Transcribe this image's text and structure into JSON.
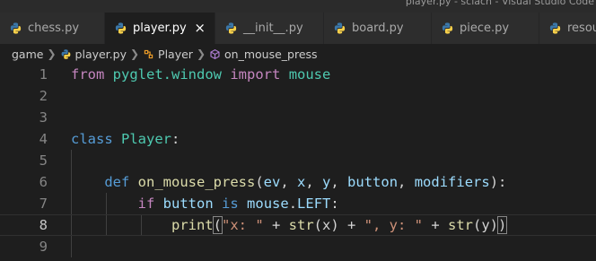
{
  "window": {
    "title": "player.py - sclach - Visual Studio Code"
  },
  "tabs": [
    {
      "label": "chess.py",
      "active": false
    },
    {
      "label": "player.py",
      "active": true,
      "close": "×"
    },
    {
      "label": "__init__.py",
      "active": false
    },
    {
      "label": "board.py",
      "active": false
    },
    {
      "label": "piece.py",
      "active": false
    },
    {
      "label": "resour",
      "active": false
    }
  ],
  "breadcrumbs": {
    "folder": "game",
    "file": "player.py",
    "class": "Player",
    "method": "on_mouse_press"
  },
  "editor": {
    "line_numbers": [
      "1",
      "2",
      "3",
      "4",
      "5",
      "6",
      "7",
      "8",
      "9"
    ],
    "current_line": "8",
    "lines": {
      "l1": {
        "kw_from": "from",
        "module": "pyglet.window",
        "kw_import": "import",
        "name": "mouse"
      },
      "l4": {
        "kw_class": "class",
        "class_name": "Player",
        "colon": ":"
      },
      "l6": {
        "kw_def": "def",
        "fn_name": "on_mouse_press",
        "open": "(",
        "p1": "ev",
        "c1": ", ",
        "p2": "x",
        "c2": ", ",
        "p3": "y",
        "c3": ", ",
        "p4": "button",
        "c4": ", ",
        "p5": "modifiers",
        "close": "):"
      },
      "l7": {
        "kw_if": "if",
        "var": "button",
        "kw_is": "is",
        "obj": "mouse",
        "dot": ".",
        "attr": "LEFT",
        "colon": ":"
      },
      "l8": {
        "fn_print": "print",
        "open": "(",
        "s1": "\"x: \"",
        "plus1": " + ",
        "fn_str1": "str",
        "arg1": "(x)",
        "plus2": " + ",
        "s2": "\", y: \"",
        "plus3": " + ",
        "fn_str2": "str",
        "arg2": "(y)",
        "close": ")"
      }
    }
  },
  "colors": {
    "background": "#1e1e1e",
    "keyword_control": "#c586c0",
    "keyword": "#569cd6",
    "class_name": "#4ec9b0",
    "function": "#dcdcaa",
    "parameter": "#9cdcfe",
    "string": "#ce9178"
  },
  "icons": {
    "tab_file": "python-icon",
    "bc_class": "class-icon",
    "bc_method": "method-icon"
  }
}
